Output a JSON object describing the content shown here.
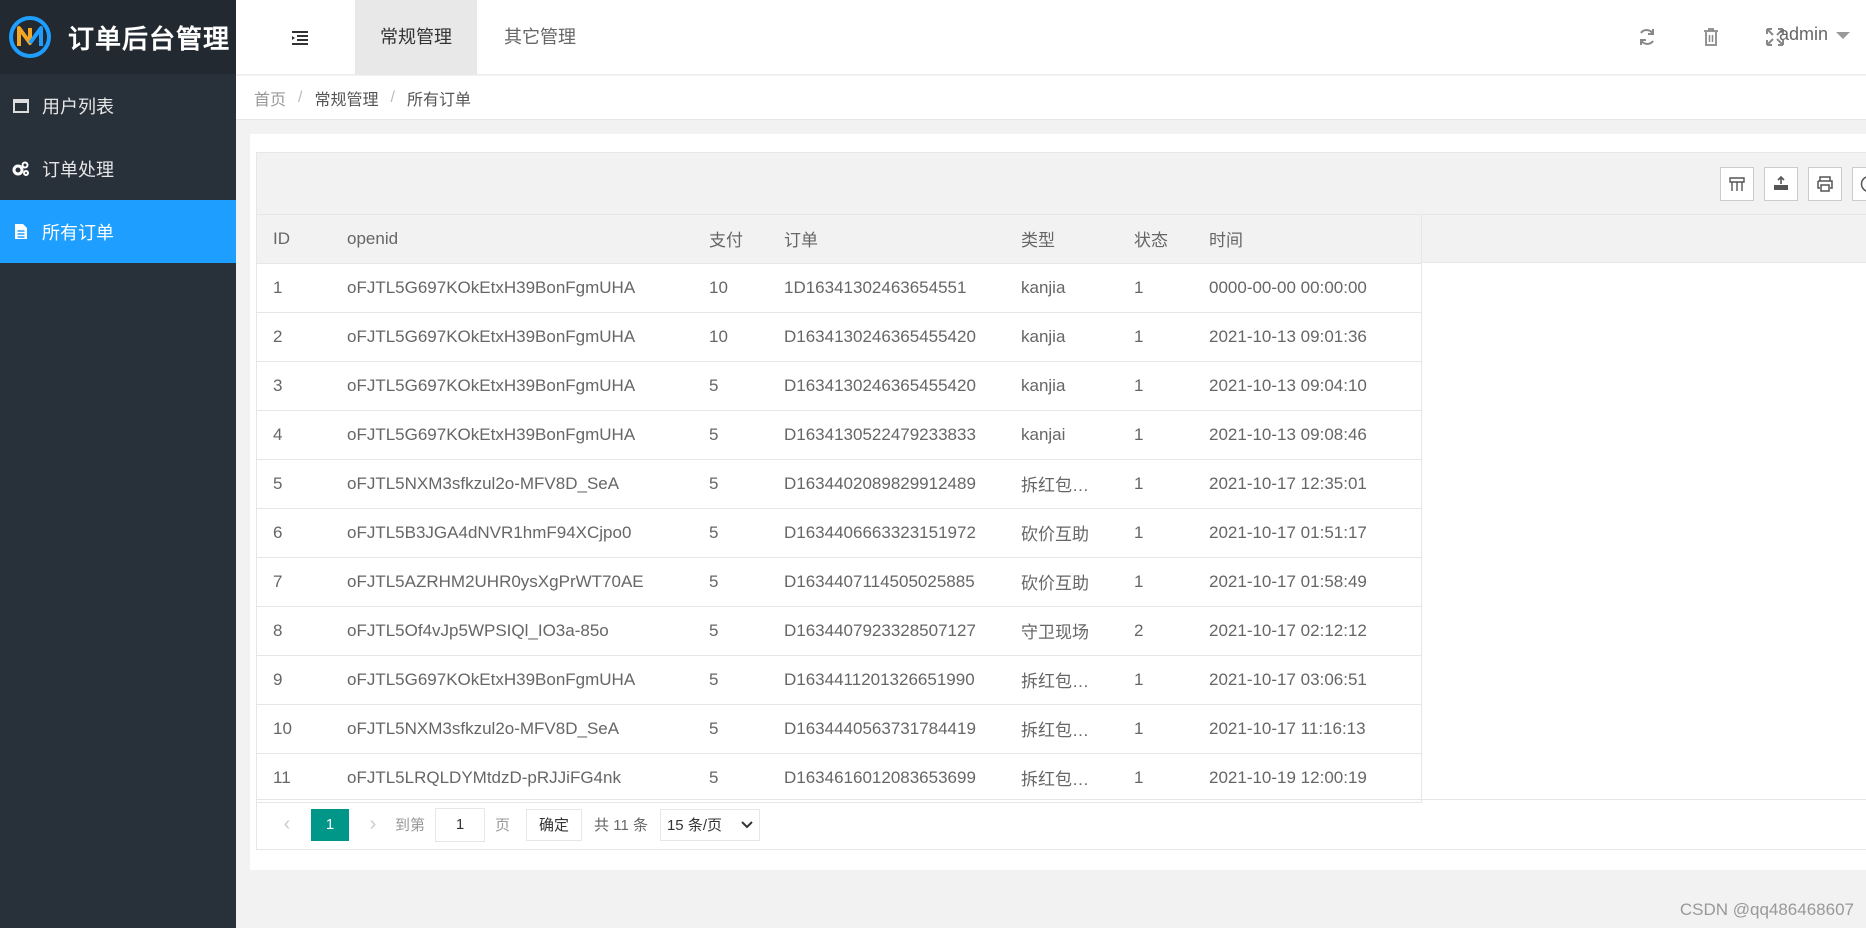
{
  "app": {
    "title": "订单后台管理"
  },
  "sidebar": {
    "items": [
      {
        "label": "用户列表",
        "icon": "window-icon"
      },
      {
        "label": "订单处理",
        "icon": "gears-icon"
      },
      {
        "label": "所有订单",
        "icon": "file-icon",
        "active": true
      }
    ]
  },
  "header": {
    "tabs": [
      {
        "label": "常规管理",
        "active": true
      },
      {
        "label": "其它管理",
        "active": false
      }
    ],
    "user": "admin"
  },
  "breadcrumb": [
    "首页",
    "常规管理",
    "所有订单"
  ],
  "table": {
    "columns": [
      "ID",
      "openid",
      "支付",
      "订单",
      "类型",
      "状态",
      "时间"
    ],
    "rows": [
      [
        "1",
        "oFJTL5G697KOkEtxH39BonFgmUHA",
        "10",
        "1D16341302463654551",
        "kanjia",
        "1",
        "0000-00-00 00:00:00"
      ],
      [
        "2",
        "oFJTL5G697KOkEtxH39BonFgmUHA",
        "10",
        "D1634130246365455420",
        "kanjia",
        "1",
        "2021-10-13 09:01:36"
      ],
      [
        "3",
        "oFJTL5G697KOkEtxH39BonFgmUHA",
        "5",
        "D1634130246365455420",
        "kanjia",
        "1",
        "2021-10-13 09:04:10"
      ],
      [
        "4",
        "oFJTL5G697KOkEtxH39BonFgmUHA",
        "5",
        "D1634130522479233833",
        "kanjai",
        "1",
        "2021-10-13 09:08:46"
      ],
      [
        "5",
        "oFJTL5NXM3sfkzul2o-MFV8D_SeA",
        "5",
        "D1634402089829912489",
        "拆红包助力",
        "1",
        "2021-10-17 12:35:01"
      ],
      [
        "6",
        "oFJTL5B3JGA4dNVR1hmF94XCjpo0",
        "5",
        "D1634406663323151972",
        "砍价互助",
        "1",
        "2021-10-17 01:51:17"
      ],
      [
        "7",
        "oFJTL5AZRHM2UHR0ysXgPrWT70AE",
        "5",
        "D1634407114505025885",
        "砍价互助",
        "1",
        "2021-10-17 01:58:49"
      ],
      [
        "8",
        "oFJTL5Of4vJp5WPSIQl_IO3a-85o",
        "5",
        "D1634407923328507127",
        "守卫现场",
        "2",
        "2021-10-17 02:12:12"
      ],
      [
        "9",
        "oFJTL5G697KOkEtxH39BonFgmUHA",
        "5",
        "D1634411201326651990",
        "拆红包助力",
        "1",
        "2021-10-17 03:06:51"
      ],
      [
        "10",
        "oFJTL5NXM3sfkzul2o-MFV8D_SeA",
        "5",
        "D1634440563731784419",
        "拆红包助力",
        "1",
        "2021-10-17 11:16:13"
      ],
      [
        "11",
        "oFJTL5LRQLDYMtdzD-pRJJiFG4nk",
        "5",
        "D1634616012083653699",
        "拆红包助力",
        "1",
        "2021-10-19 12:00:19"
      ]
    ]
  },
  "pager": {
    "current": "1",
    "goto_label": "到第",
    "page_value": "1",
    "page_unit": "页",
    "confirm": "确定",
    "total": "共 11 条",
    "page_size": "15 条/页"
  },
  "watermark": "CSDN @qq486468607",
  "colors": {
    "sidebar": "#28303a",
    "active": "#1e9fff",
    "pager_active": "#009688"
  }
}
